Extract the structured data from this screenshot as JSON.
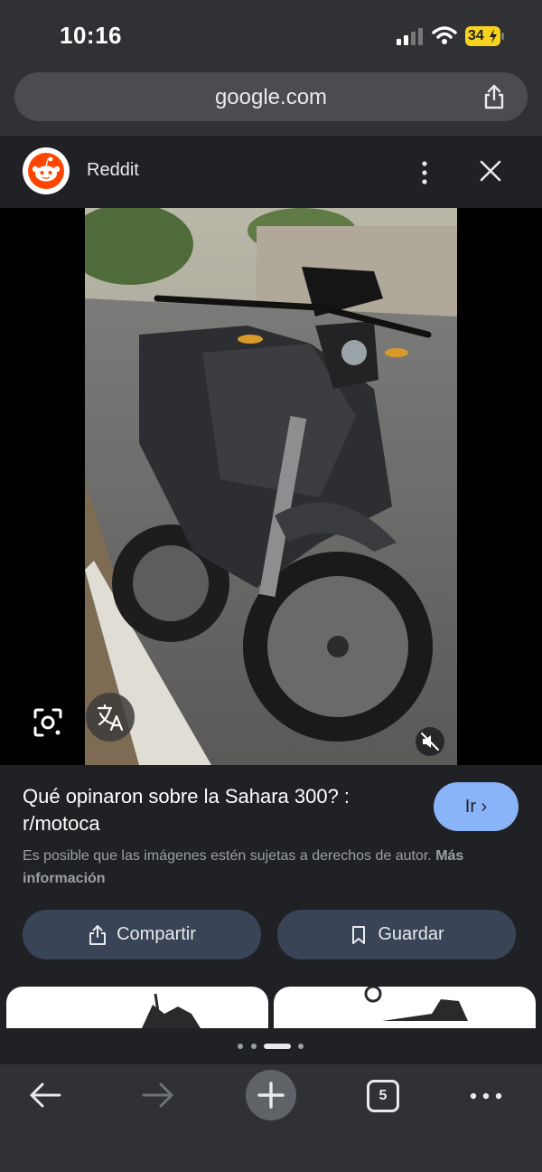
{
  "status": {
    "time": "10:16",
    "battery": "34",
    "icons": [
      "cellular-signal-icon",
      "wifi-icon",
      "battery-charging-icon"
    ]
  },
  "browser": {
    "url": "google.com",
    "share_icon": "share-icon"
  },
  "source": {
    "name": "Reddit",
    "logo": "reddit-logo",
    "menu_icon": "more-vert-icon",
    "close_icon": "close-icon"
  },
  "image": {
    "subject": "motorcycle-photo",
    "overlay_icons": [
      "google-lens-icon",
      "translate-icon",
      "mute-icon"
    ]
  },
  "result": {
    "title": "Qué opinaron sobre la Sahara 300? : r/motoca",
    "go_button": "Ir ›",
    "notice_text": "Es posible que las imágenes estén sujetas a derechos de autor.",
    "notice_link": "Más información",
    "share_button": "Compartir",
    "save_button": "Guardar"
  },
  "toolbar": {
    "tab_count": "5",
    "icons": [
      "back-arrow-icon",
      "forward-arrow-icon",
      "new-tab-plus-icon",
      "tab-switcher-icon",
      "more-horiz-icon"
    ]
  },
  "colors": {
    "background": "#202124",
    "toolbar": "#303134",
    "accent": "#8ab4f8",
    "action_button": "#394457",
    "reddit": "#ff4500"
  }
}
